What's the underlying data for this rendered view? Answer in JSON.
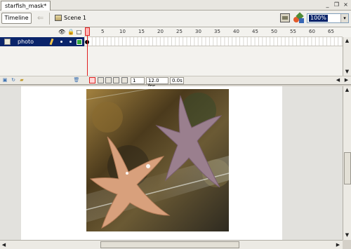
{
  "document": {
    "tab_title": "starfish_mask*"
  },
  "window_controls": {
    "minimize": "_",
    "restore": "❐",
    "close": "×"
  },
  "toolbar": {
    "timeline_button": "Timeline",
    "scene_label": "Scene 1",
    "zoom": {
      "value": "100%",
      "dropdown_glyph": "▾"
    }
  },
  "timeline": {
    "header_icons": {
      "eye": "👁",
      "lock": "🔒",
      "outline": "□"
    },
    "frame_numbers": [
      "1",
      "5",
      "10",
      "15",
      "20",
      "25",
      "30",
      "35",
      "40",
      "45",
      "50",
      "55",
      "60",
      "65"
    ],
    "layers": [
      {
        "name": "photo",
        "selected": true
      }
    ],
    "status": {
      "current_frame": "1",
      "frame_rate": "12.0 fps",
      "elapsed": "0.0s"
    },
    "bottom_icons": [
      "insert-layer-icon",
      "add-motion-guide-icon",
      "insert-folder-icon",
      "delete-layer-icon",
      "center-frame-icon",
      "onion-skin-icon",
      "onion-skin-outlines-icon",
      "edit-multiple-frames-icon",
      "modify-onion-markers-icon"
    ]
  },
  "scrollbar_glyphs": {
    "up": "▲",
    "down": "▼",
    "left": "◀",
    "right": "▶"
  },
  "colors": {
    "selection": "#0a246a",
    "playhead": "#e02020",
    "stage": "#ffffff",
    "workspace": "#e2e1dd"
  },
  "stage": {
    "image": "photo of two starfish in an aquarium, one orange and one pinkish-purple"
  }
}
